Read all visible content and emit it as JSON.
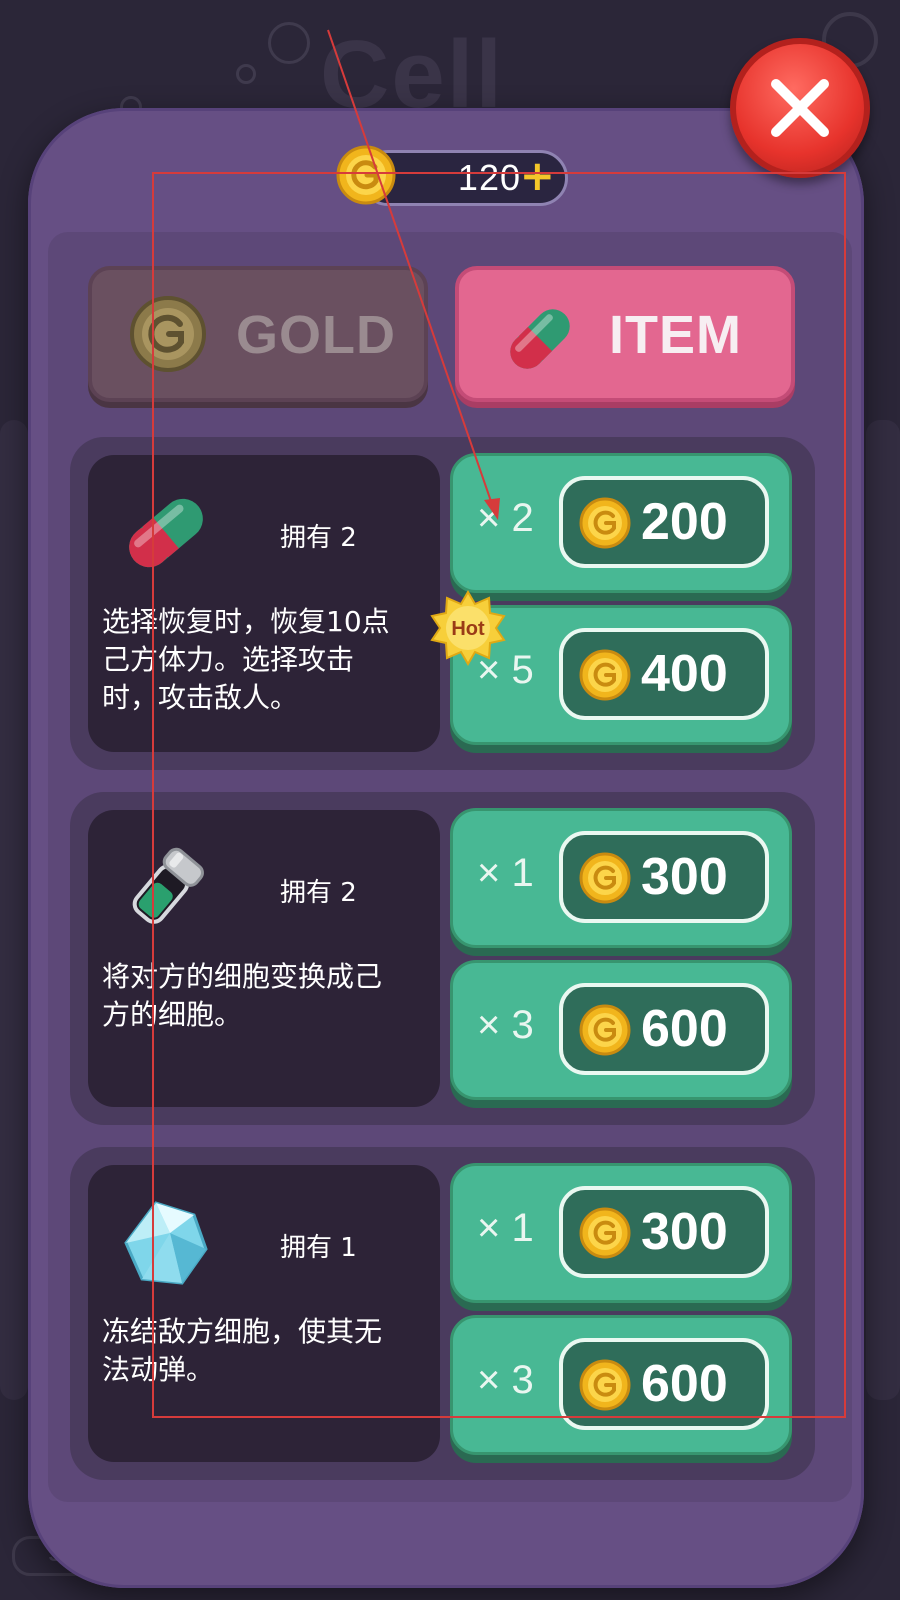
{
  "background": {
    "title": "Cell",
    "bottom_button": "SHO"
  },
  "header": {
    "coins": "120",
    "plus": "+"
  },
  "tabs": [
    {
      "label": "GOLD",
      "active": false
    },
    {
      "label": "ITEM",
      "active": true
    }
  ],
  "items": [
    {
      "icon": "capsule-icon",
      "owned": "拥有 2",
      "description": "选择恢复时，恢复10点己方体力。选择攻击时，攻击敌人。",
      "offers": [
        {
          "qty": "× 2",
          "price": "200"
        },
        {
          "qty": "× 5",
          "price": "400",
          "badge": "Hot"
        }
      ]
    },
    {
      "icon": "syringe-vial-icon",
      "owned": "拥有 2",
      "description": "将对方的细胞变换成己方的细胞。",
      "offers": [
        {
          "qty": "× 1",
          "price": "300"
        },
        {
          "qty": "× 3",
          "price": "600"
        }
      ]
    },
    {
      "icon": "ice-crystal-icon",
      "owned": "拥有 1",
      "description": "冻结敌方细胞，使其无法动弹。",
      "offers": [
        {
          "qty": "× 1",
          "price": "300"
        },
        {
          "qty": "× 3",
          "price": "600"
        }
      ]
    }
  ],
  "colors": {
    "panel": "#664f84",
    "buy_button": "#48b894",
    "active_tab": "#e36790",
    "coin": "#f5c72a",
    "annotation": "#d63b3b"
  }
}
